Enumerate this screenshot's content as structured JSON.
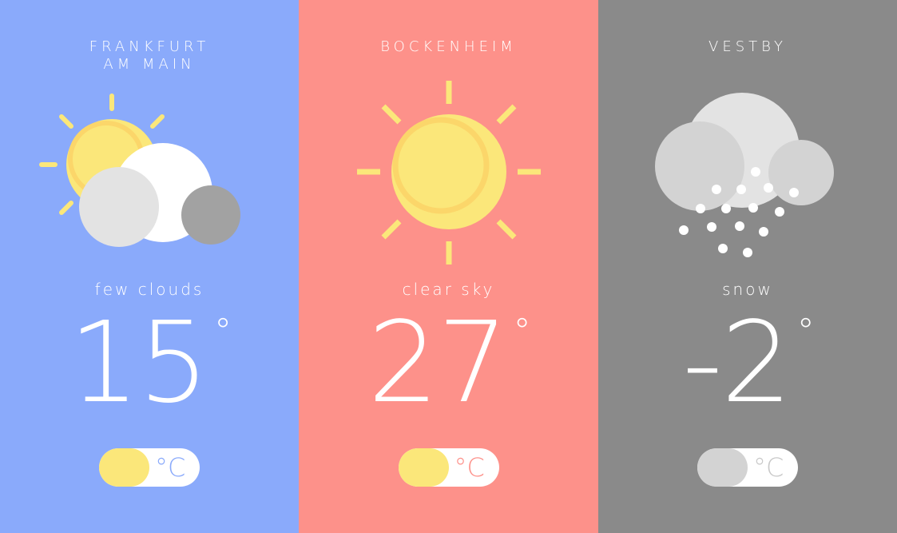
{
  "cards": [
    {
      "city_line1": "FRANKFURT",
      "city_line2": "AM MAIN",
      "description": "few clouds",
      "temperature": "15",
      "degree_symbol": "°",
      "unit": "°C",
      "icon": "few-clouds-icon",
      "colors": {
        "background": "#8aaafb",
        "knob": "#fbe77a",
        "unit": "#8aaafb"
      }
    },
    {
      "city_line1": "BOCKENHEIM",
      "city_line2": "",
      "description": "clear sky",
      "temperature": "27",
      "degree_symbol": "°",
      "unit": "°C",
      "icon": "sun-icon",
      "colors": {
        "background": "#fd918a",
        "knob": "#fbe77a",
        "unit": "#fd918a"
      }
    },
    {
      "city_line1": "VESTBY",
      "city_line2": "",
      "description": "snow",
      "temperature": "-2",
      "degree_symbol": "°",
      "unit": "°C",
      "icon": "snow-cloud-icon",
      "colors": {
        "background": "#8a8a8a",
        "knob": "#d3d3d3",
        "unit": "#c8c8c8"
      }
    }
  ]
}
